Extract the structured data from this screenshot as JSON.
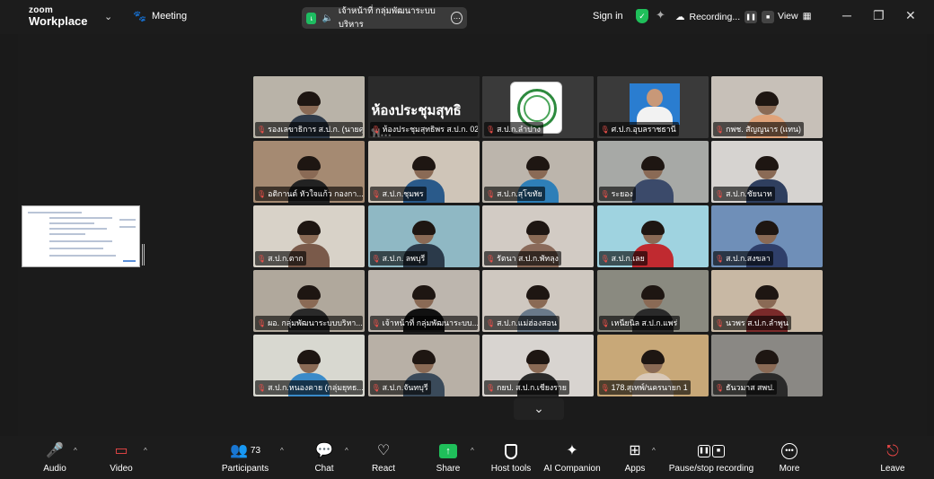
{
  "header": {
    "brand_line1": "zoom",
    "brand_line2": "Workplace",
    "meeting_label": "Meeting",
    "speaker_initial": "เ",
    "speaker_name": "เจ้าหน้าที่ กลุ่มพัฒนาระบบบริหาร",
    "sign_in": "Sign in",
    "recording": "Recording...",
    "view": "View"
  },
  "tiles": [
    {
      "label": "รองเลขาธิการ ส.ป.ก. (นายศุรชั...",
      "bg": "#b9b3a8",
      "body": "#2f3b4a",
      "active": true
    },
    {
      "label": "ห้องประชุมสุทธิพร ส.ป.ก. 02",
      "title": "ห้องประชุมสุทธิพ...",
      "bg": "#2b2b2b",
      "room": true
    },
    {
      "label": "ส.ป.ก.ลำปาง",
      "bg": "#3a3a3a",
      "seal": true
    },
    {
      "label": "ศ.ป.ก.อุบลราชธานี",
      "bg": "#3a3a3a",
      "officer": true
    },
    {
      "label": "กพช. สัญญนาร (แทน)",
      "bg": "#c7c0b8",
      "body": "#e0a37a"
    },
    {
      "label": "อติกานต์ หัวใจแก้ว กองกา...",
      "bg": "#a58a72",
      "body": "#222"
    },
    {
      "label": "ส.ป.ก.ชุมพร",
      "bg": "#cfc5b8",
      "body": "#2a5a8a"
    },
    {
      "label": "ส.ป.ก.สุโขทัย",
      "bg": "#bcb5ac",
      "body": "#2e7fb8"
    },
    {
      "label": "ระยอง",
      "bg": "#a7a9a6",
      "body": "#3b4a6a"
    },
    {
      "label": "ส.ป.ก.ชัยนาท",
      "bg": "#d6d3d0",
      "body": "#2f3f5f"
    },
    {
      "label": "ส.ป.ก.ตาก",
      "bg": "#d8d2c8",
      "body": "#7a5a4a"
    },
    {
      "label": "ส.ป.ก. ลพบุรี",
      "bg": "#8fb8c4",
      "body": "#2b3a4a"
    },
    {
      "label": "รัตนา ส.ป.ก.พัทลุง",
      "bg": "#d2cbc4",
      "body": "#8a6a5a"
    },
    {
      "label": "ส.ป.ก.เลย",
      "bg": "#9fd3e0",
      "body": "#c02a30"
    },
    {
      "label": "ส.ป.ก.สงขลา",
      "bg": "#6f8fb8",
      "body": "#2f3f6a"
    },
    {
      "label": "ผอ. กลุ่มพัฒนาระบบบริหา...",
      "bg": "#b0a89c",
      "body": "#2a2a2a"
    },
    {
      "label": "เจ้าหน้าที่ กลุ่มพัฒนาระบบ...",
      "bg": "#bdb6ae",
      "body": "#111"
    },
    {
      "label": "ส.ป.ก.แม่ฮ่องสอน",
      "bg": "#cfc8c0",
      "body": "#6a7a8a"
    },
    {
      "label": "เหนียนิล ส.ป.ก.แพร่",
      "bg": "#8a8a80",
      "body": "#2a2a2a"
    },
    {
      "label": "นวพร ส.ป.ก.ลำพูน",
      "bg": "#c8b8a4",
      "body": "#7a2a2a"
    },
    {
      "label": "ส.ป.ก.หนองคาย (กลุ่มยุทธ...",
      "bg": "#d8d8d0",
      "body": "#3a8ac8"
    },
    {
      "label": "ส.ป.ก.จันทบุรี",
      "bg": "#b8b0a6",
      "body": "#3a4a5a"
    },
    {
      "label": "กยป. ส.ป.ก.เชียงราย",
      "bg": "#d8d4d0",
      "body": "#2a2a2a"
    },
    {
      "label": "178.สุเทพ์/นครนายก 1",
      "bg": "#c8a878",
      "body": "#d8c8b8"
    },
    {
      "label": "ธันวมาส สพป.",
      "bg": "#8a8884",
      "body": "#2a2a2a"
    }
  ],
  "toolbar": {
    "audio": "Audio",
    "video": "Video",
    "participants": "Participants",
    "participants_count": "73",
    "chat": "Chat",
    "react": "React",
    "share": "Share",
    "host_tools": "Host tools",
    "ai_companion": "AI Companion",
    "apps": "Apps",
    "pause_stop": "Pause/stop recording",
    "more": "More",
    "leave": "Leave"
  }
}
